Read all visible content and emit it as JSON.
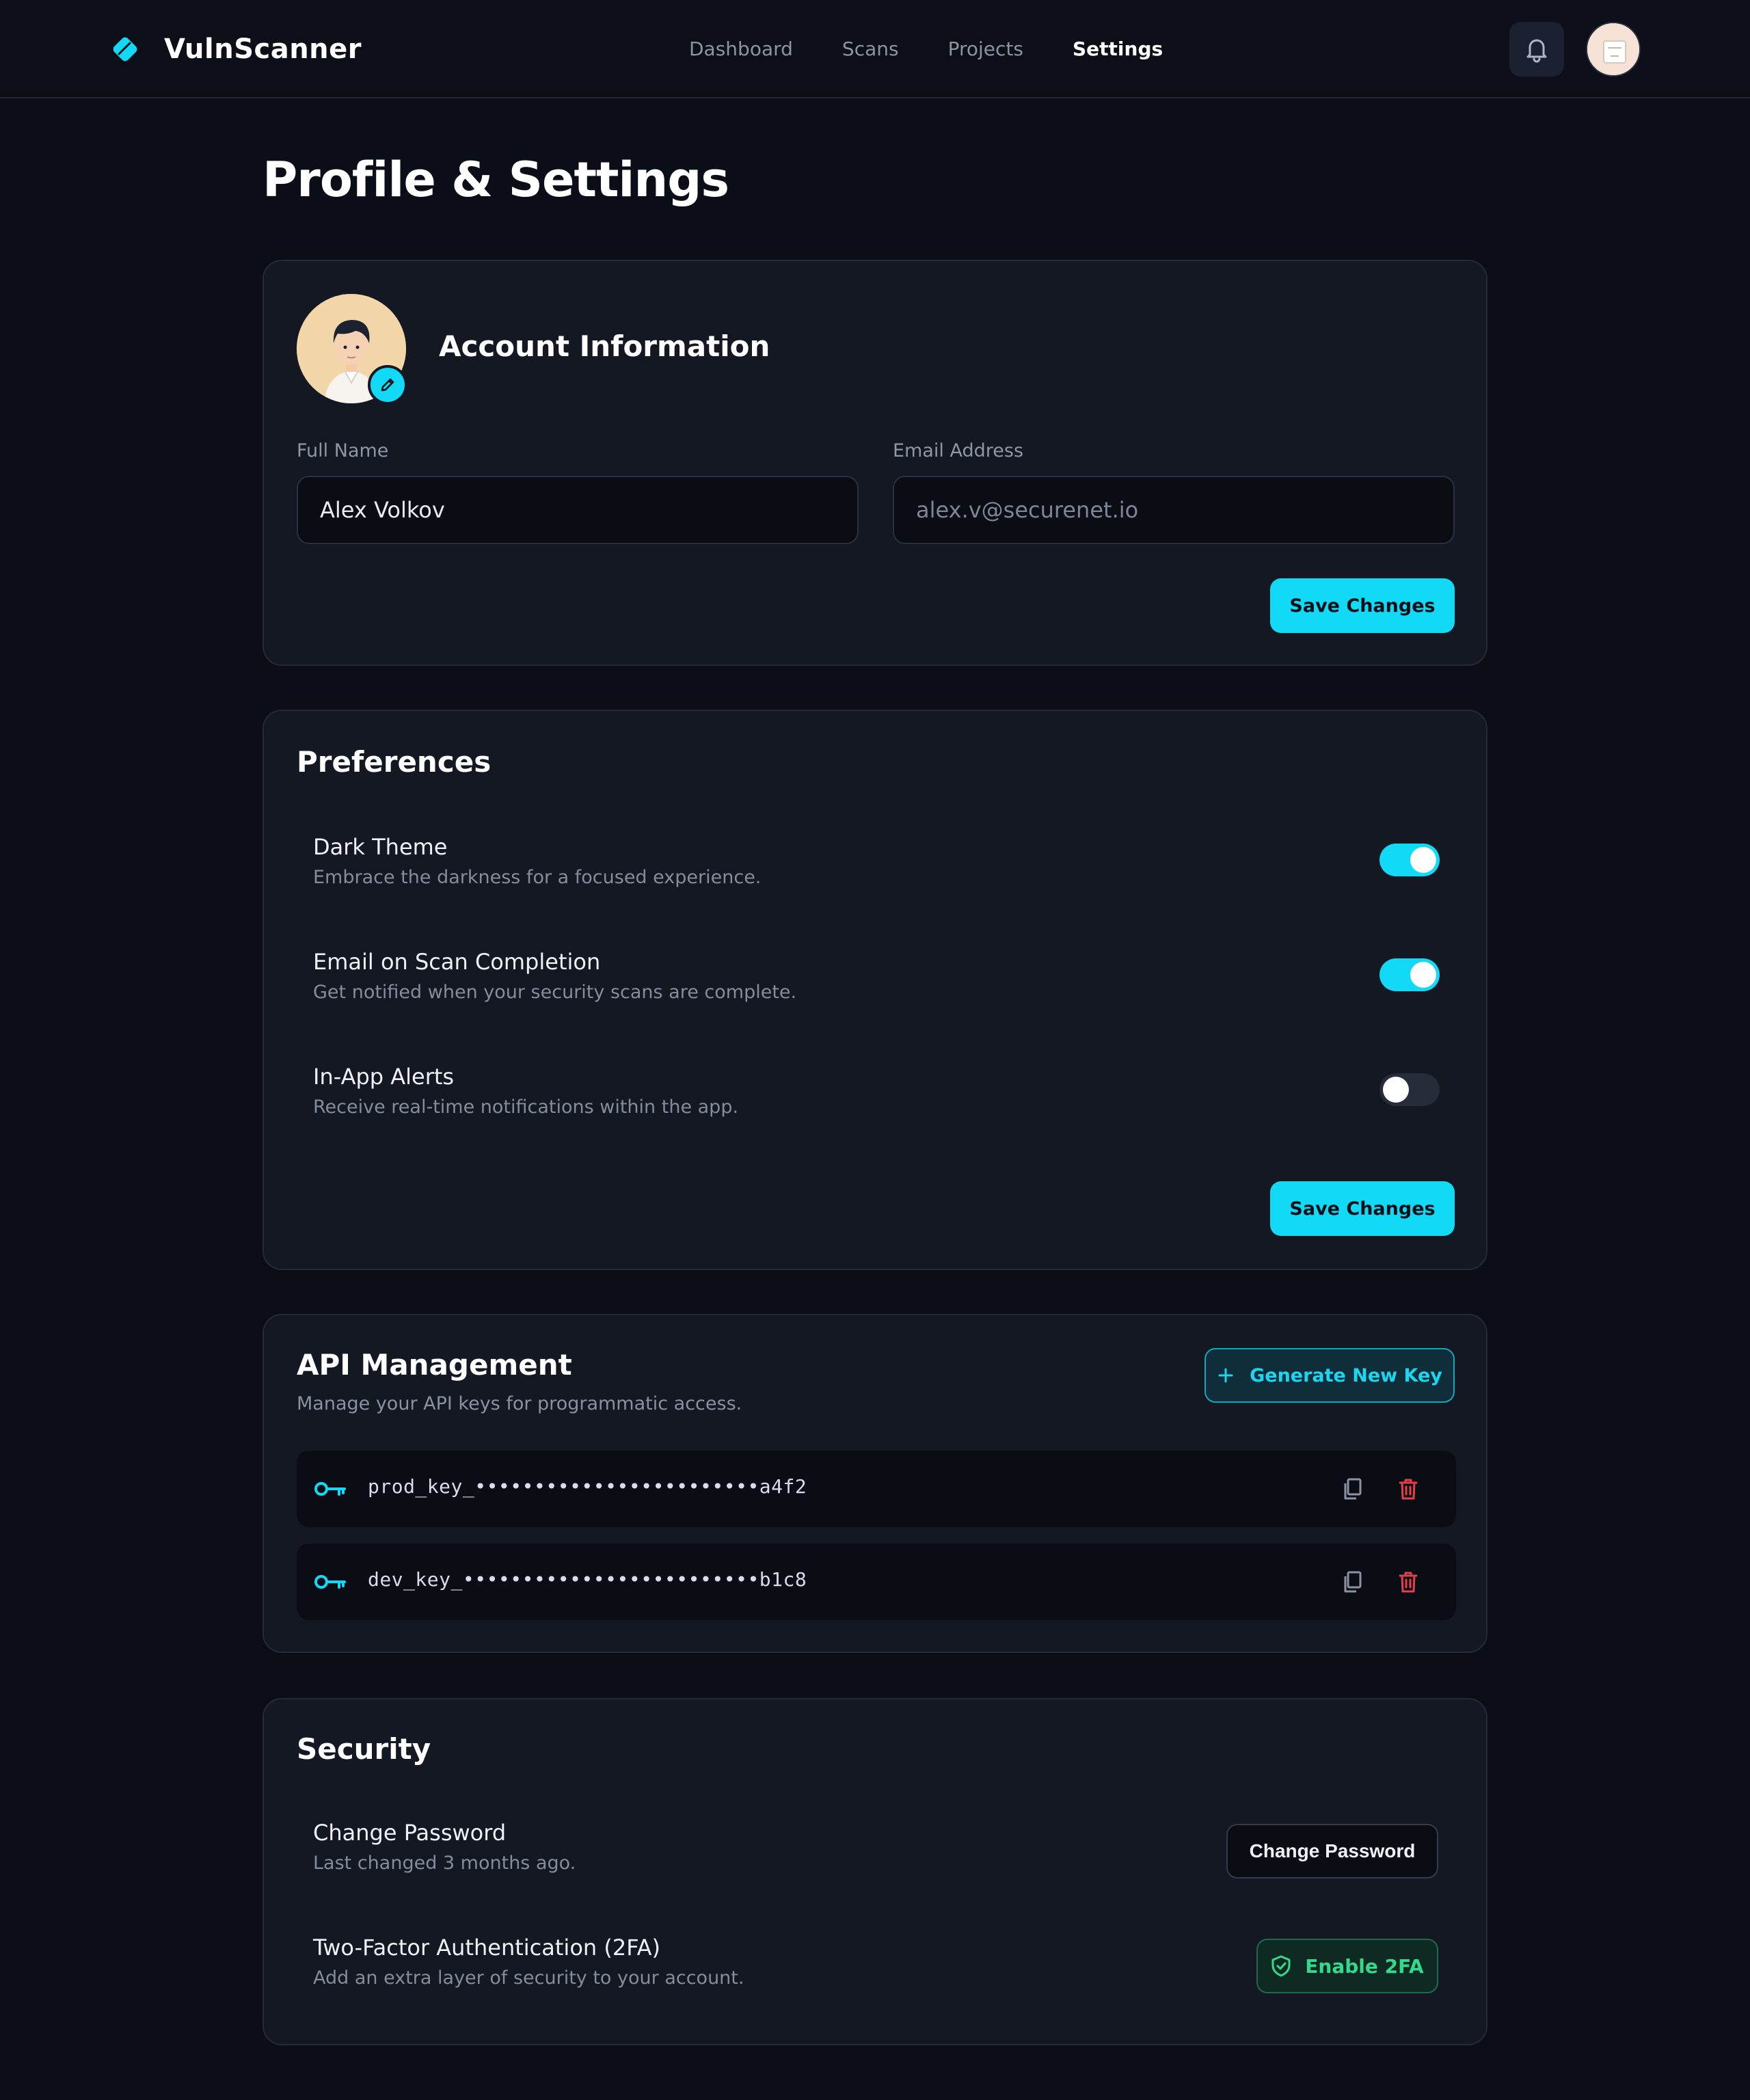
{
  "colors": {
    "accent": "#12d9f5",
    "background": "#0b0e16",
    "card": "#131823",
    "danger": "#e0414a",
    "success": "#34d98c"
  },
  "header": {
    "app_name": "VulnScanner",
    "logo_icon": "diamond-logo-icon",
    "nav": [
      {
        "label": "Dashboard",
        "active": false
      },
      {
        "label": "Scans",
        "active": false
      },
      {
        "label": "Projects",
        "active": false
      },
      {
        "label": "Settings",
        "active": true
      }
    ],
    "notifications_icon": "bell-icon"
  },
  "page": {
    "title": "Profile & Settings"
  },
  "account": {
    "title": "Account Information",
    "full_name_label": "Full Name",
    "full_name_value": "Alex Volkov",
    "email_label": "Email Address",
    "email_placeholder": "alex.v@securenet.io",
    "save_label": "Save Changes",
    "edit_avatar_icon": "pencil-icon"
  },
  "preferences": {
    "title": "Preferences",
    "items": [
      {
        "title": "Dark Theme",
        "description": "Embrace the darkness for a focused experience.",
        "enabled": true
      },
      {
        "title": "Email on Scan Completion",
        "description": "Get notified when your security scans are complete.",
        "enabled": true
      },
      {
        "title": "In-App Alerts",
        "description": "Receive real-time notifications within the app.",
        "enabled": false
      }
    ],
    "save_label": "Save Changes"
  },
  "api": {
    "title": "API Management",
    "subtitle": "Manage your API keys for programmatic access.",
    "generate_label": "Generate New Key",
    "keys": [
      {
        "value": "prod_key_••••••••••••••••••••••••a4f2",
        "icon": "key-icon"
      },
      {
        "value": "dev_key_•••••••••••••••••••••••••b1c8",
        "icon": "key-icon"
      }
    ]
  },
  "security": {
    "title": "Security",
    "password_title": "Change Password",
    "password_desc": "Last changed 3 months ago.",
    "password_button": "Change Password",
    "twofa_title": "Two-Factor Authentication (2FA)",
    "twofa_desc": "Add an extra layer of security to your account.",
    "twofa_button": "Enable 2FA"
  }
}
